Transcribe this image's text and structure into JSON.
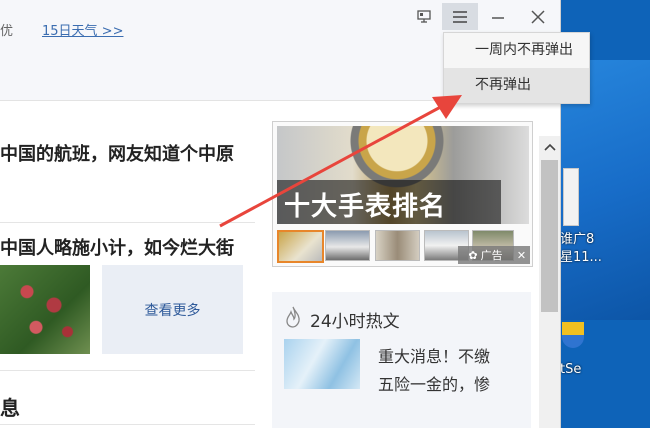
{
  "desktop": {
    "labels": [
      "谁广8",
      "星11...",
      "tSe"
    ]
  },
  "window": {
    "weather_fragment": "优",
    "weather_link": "15日天气 >>",
    "menu_items": [
      "一周内不再弹出",
      "不再弹出"
    ]
  },
  "news": {
    "headline1": "中国的航班，网友知道个中原",
    "headline2": "中国人略施小计，如今烂大街",
    "more_label": "查看更多",
    "bottom_title": "息"
  },
  "ad": {
    "caption": "十大手表排名",
    "tag": "广告",
    "close": "✕"
  },
  "hot": {
    "title": "24小时热文",
    "line1": "重大消息！不缴",
    "line2": "五险一金的，惨"
  },
  "colors": {
    "arrow": "#e8453c",
    "link": "#3b6db0",
    "desktop_bg": "#0e63b8"
  }
}
